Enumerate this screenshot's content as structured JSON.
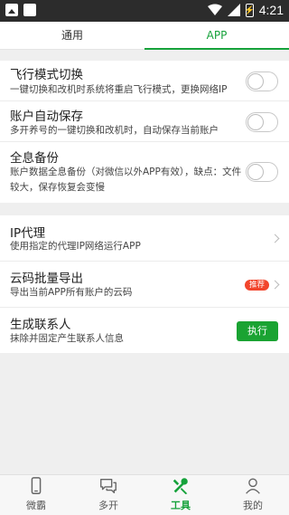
{
  "status_bar": {
    "time": "4:21",
    "battery_glyph": "⚡"
  },
  "tabs": [
    {
      "label": "通用",
      "active": false
    },
    {
      "label": "APP",
      "active": true
    }
  ],
  "section1": [
    {
      "title": "飞行模式切换",
      "desc": "一键切换和改机时系统将重启飞行模式，更换网络IP",
      "toggle_on": false
    },
    {
      "title": "账户自动保存",
      "desc": "多开养号的一键切换和改机时，自动保存当前账户",
      "toggle_on": false
    },
    {
      "title": "全息备份",
      "desc": "账户数据全息备份（对微信以外APP有效），缺点：文件较大，保存恢复会变慢",
      "toggle_on": false
    }
  ],
  "section2": [
    {
      "title": "IP代理",
      "desc": "使用指定的代理IP网络运行APP"
    },
    {
      "title": "云码批量导出",
      "desc": "导出当前APP所有账户的云码",
      "badge": "推荐"
    },
    {
      "title": "生成联系人",
      "desc": "抹除并固定产生联系人信息",
      "button": "执行"
    }
  ],
  "bottom_nav": [
    {
      "label": "微霸",
      "icon": "phone-icon",
      "active": false
    },
    {
      "label": "多开",
      "icon": "chat-icon",
      "active": false
    },
    {
      "label": "工具",
      "icon": "tools-icon",
      "active": true
    },
    {
      "label": "我的",
      "icon": "person-icon",
      "active": false
    }
  ],
  "colors": {
    "accent": "#16a23b",
    "badge": "#f2452c",
    "exec_button": "#1aa332"
  }
}
